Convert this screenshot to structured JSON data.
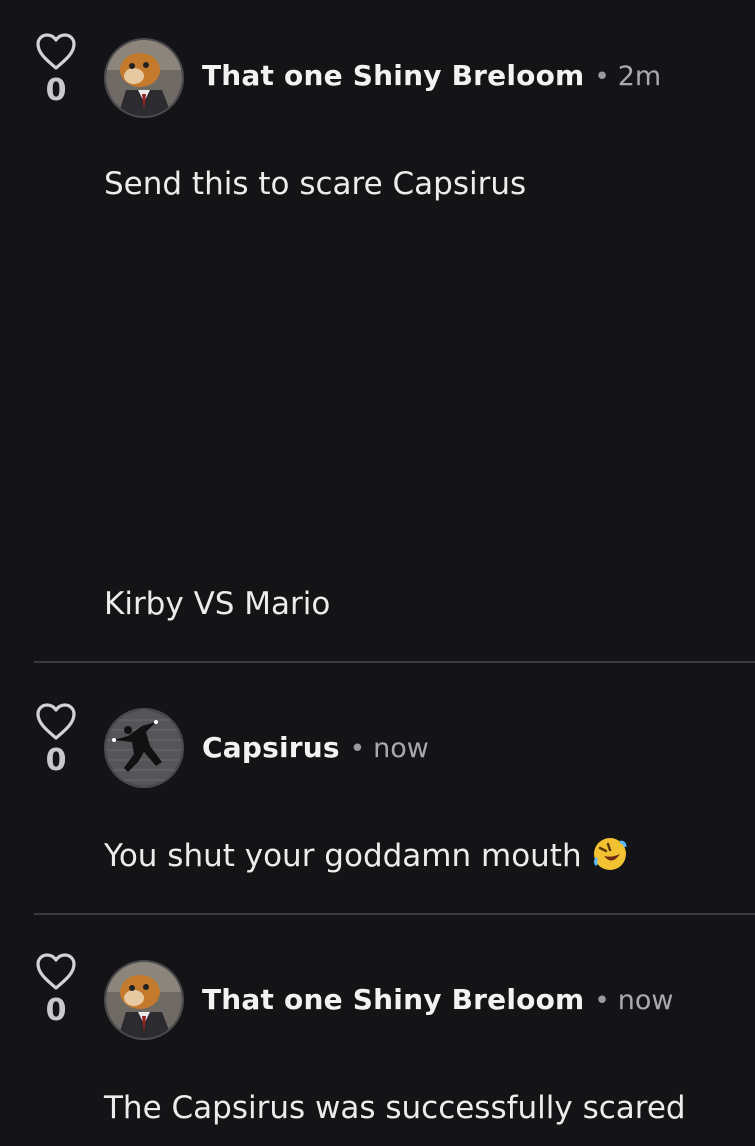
{
  "comments": [
    {
      "likes": "0",
      "author": "That one Shiny Breloom",
      "separator": "•",
      "time": "2m",
      "text": "Send this to scare Capsirus",
      "caption": "Kirby VS Mario"
    },
    {
      "likes": "0",
      "author": "Capsirus",
      "separator": "•",
      "time": "now",
      "text": "You shut your goddamn mouth",
      "emoji": "rolling-on-floor-laughing"
    },
    {
      "likes": "0",
      "author": "That one Shiny Breloom",
      "separator": "•",
      "time": "now",
      "text": "The Capsirus was successfully scared"
    }
  ],
  "colors": {
    "background": "#141417",
    "text": "#ececec",
    "muted": "#a9a9ae",
    "divider": "#3a3a3f"
  },
  "icons": {
    "like": "heart-outline-icon"
  }
}
